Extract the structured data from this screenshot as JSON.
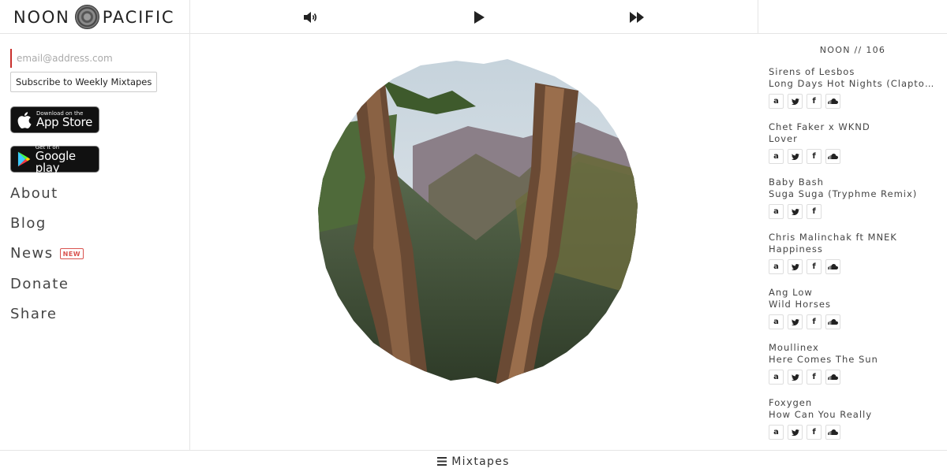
{
  "brand": {
    "left": "NOON",
    "right": "PACIFIC"
  },
  "signup": {
    "placeholder": "email@address.com",
    "button": "Subscribe to Weekly Mixtapes"
  },
  "badges": {
    "app_store": {
      "small": "Download on the",
      "big": "App Store"
    },
    "google_play": {
      "small": "Get it on",
      "big": "Google play"
    }
  },
  "nav": {
    "about": "About",
    "blog": "Blog",
    "news": "News",
    "news_badge": "NEW",
    "donate": "Donate",
    "share": "Share"
  },
  "controls": {
    "volume_icon": "volume-icon",
    "play_icon": "play-icon",
    "skip_icon": "fast-forward-icon"
  },
  "playlist": {
    "title": "NOON // 106",
    "tracks": [
      {
        "artist": "Sirens of Lesbos",
        "song": "Long Days Hot Nights (Claptone Remix)",
        "soundcloud": true
      },
      {
        "artist": "Chet Faker x WKND",
        "song": "Lover",
        "soundcloud": true
      },
      {
        "artist": "Baby Bash",
        "song": "Suga Suga (Tryphme Remix)",
        "soundcloud": false
      },
      {
        "artist": "Chris Malinchak ft MNEK",
        "song": "Happiness",
        "soundcloud": true
      },
      {
        "artist": "Ang Low",
        "song": "Wild Horses",
        "soundcloud": true
      },
      {
        "artist": "Moullinex",
        "song": "Here Comes The Sun",
        "soundcloud": true
      },
      {
        "artist": "Foxygen",
        "song": "How Can You Really",
        "soundcloud": true
      }
    ],
    "icon_labels": {
      "amazon": "a",
      "facebook": "f"
    }
  },
  "footer": {
    "label": "Mixtapes"
  },
  "colors": {
    "accent_red": "#d9534f",
    "border": "#e5e5e5"
  }
}
